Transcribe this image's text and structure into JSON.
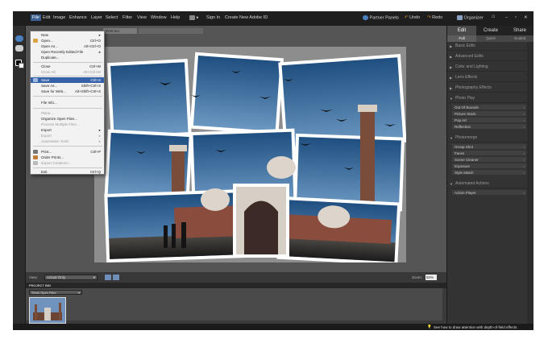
{
  "menubar": {
    "items": [
      "File",
      "Edit",
      "Image",
      "Enhance",
      "Layer",
      "Select",
      "Filter",
      "View",
      "Window",
      "Help"
    ],
    "signin": "Sign In",
    "create_id": "Create New Adobe ID",
    "partner_panels": "Partner Panels",
    "undo": "Undo",
    "redo": "Redo",
    "organizer": "Organizer"
  },
  "file_menu": {
    "items": [
      {
        "label": "New",
        "shortcut": "",
        "state": "normal"
      },
      {
        "label": "Open...",
        "shortcut": "Ctrl+O",
        "state": "normal"
      },
      {
        "label": "Open As...",
        "shortcut": "Alt+Ctrl+O",
        "state": "normal"
      },
      {
        "label": "Open Recently Edited File",
        "shortcut": "",
        "state": "normal"
      },
      {
        "label": "Duplicate...",
        "shortcut": "",
        "state": "normal"
      },
      {
        "label": "Close",
        "shortcut": "Ctrl+W",
        "state": "normal"
      },
      {
        "label": "Close All",
        "shortcut": "Alt+Ctrl+W",
        "state": "disabled"
      },
      {
        "label": "Save",
        "shortcut": "Ctrl+S",
        "state": "highlighted"
      },
      {
        "label": "Save As...",
        "shortcut": "Shift+Ctrl+S",
        "state": "normal"
      },
      {
        "label": "Save for Web...",
        "shortcut": "Alt+Shift+Ctrl+S",
        "state": "normal"
      },
      {
        "label": "File Info...",
        "shortcut": "",
        "state": "normal"
      },
      {
        "label": "Place...",
        "shortcut": "",
        "state": "disabled"
      },
      {
        "label": "Organize Open Files...",
        "shortcut": "",
        "state": "normal"
      },
      {
        "label": "Process Multiple Files...",
        "shortcut": "",
        "state": "disabled"
      },
      {
        "label": "Import",
        "shortcut": "",
        "state": "normal"
      },
      {
        "label": "Export",
        "shortcut": "",
        "state": "disabled"
      },
      {
        "label": "Automation Tools",
        "shortcut": "",
        "state": "disabled"
      },
      {
        "label": "Print...",
        "shortcut": "Ctrl+P",
        "state": "normal"
      },
      {
        "label": "Order Prints...",
        "shortcut": "",
        "state": "normal"
      },
      {
        "label": "Export Creations...",
        "shortcut": "",
        "state": "disabled"
      },
      {
        "label": "Exit",
        "shortcut": "Ctrl+Q",
        "state": "normal"
      }
    ]
  },
  "document": {
    "tab_label": "Print Scr"
  },
  "status": {
    "view_label": "View:",
    "view_value": "Actual Only",
    "zoom_label": "Zoom:",
    "zoom_value": "50%"
  },
  "project_bin": {
    "title": "PROJECT BIN",
    "selector": "Show Open Files"
  },
  "bottom_tip": "See how to draw attention with depth-of-field effects.",
  "panel": {
    "tabs": [
      "Edit",
      "Create",
      "Share"
    ],
    "subtabs": [
      "Full",
      "Quick",
      "Guided"
    ],
    "sections": [
      {
        "label": "Basic Edits",
        "expanded": false,
        "items": []
      },
      {
        "label": "Advanced Edits",
        "expanded": false,
        "items": []
      },
      {
        "label": "Color and Lighting",
        "expanded": false,
        "items": []
      },
      {
        "label": "Lens Effects",
        "expanded": false,
        "items": []
      },
      {
        "label": "Photography Effects",
        "expanded": false,
        "items": []
      },
      {
        "label": "Photo Play",
        "expanded": true,
        "items": [
          "Out Of Bounds",
          "Picture Stack",
          "Pop Art",
          "Reflection"
        ]
      },
      {
        "label": "Photomerge",
        "expanded": true,
        "items": [
          "Group Shot",
          "Faces",
          "Scene Cleaner",
          "Exposure",
          "Style Match"
        ]
      },
      {
        "label": "Automated Actions",
        "expanded": true,
        "items": [
          "Action Player"
        ]
      }
    ]
  },
  "colors": {
    "menubar_bg": "#1e1e1e",
    "panel_bg": "#333333",
    "highlight": "#3461a8",
    "sky": "#2f5f8e"
  }
}
